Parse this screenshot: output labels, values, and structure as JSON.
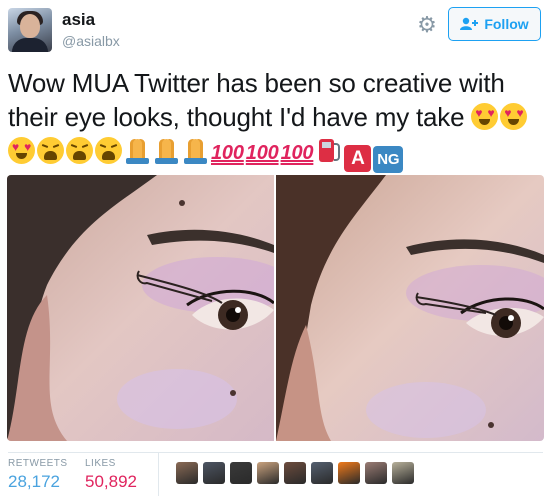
{
  "user": {
    "name": "asia",
    "handle": "@asialbx"
  },
  "follow_button": {
    "label": "Follow"
  },
  "tweet": {
    "text": "Wow MUA Twitter has been so creative with their eye looks, thought I'd have my take",
    "hundred_label": "100",
    "letter_a": "A",
    "letters_ng": "NG"
  },
  "icons": {
    "gear": "gear-icon",
    "follow": "add-user-icon",
    "emoji_sequence": [
      "heart-eyes",
      "heart-eyes",
      "heart-eyes",
      "weary",
      "weary",
      "weary",
      "pray",
      "pray",
      "pray",
      "hundred",
      "hundred",
      "hundred",
      "fuel-pump",
      "a-button",
      "ng-button"
    ]
  },
  "stats": {
    "retweets_label": "RETWEETS",
    "retweets_value": "28,172",
    "likes_label": "LIKES",
    "likes_value": "50,892"
  },
  "likers": [
    "#8a6a55",
    "#4d5563",
    "#3a3a3a",
    "#c9a27e",
    "#6d4c3d",
    "#556070",
    "#f07a1a",
    "#9a7c74",
    "#b7b09a"
  ],
  "colors": {
    "accent": "#1da1f2",
    "likes": "#e0245e",
    "retweets": "#4aa3df",
    "muted": "#8899a6"
  }
}
